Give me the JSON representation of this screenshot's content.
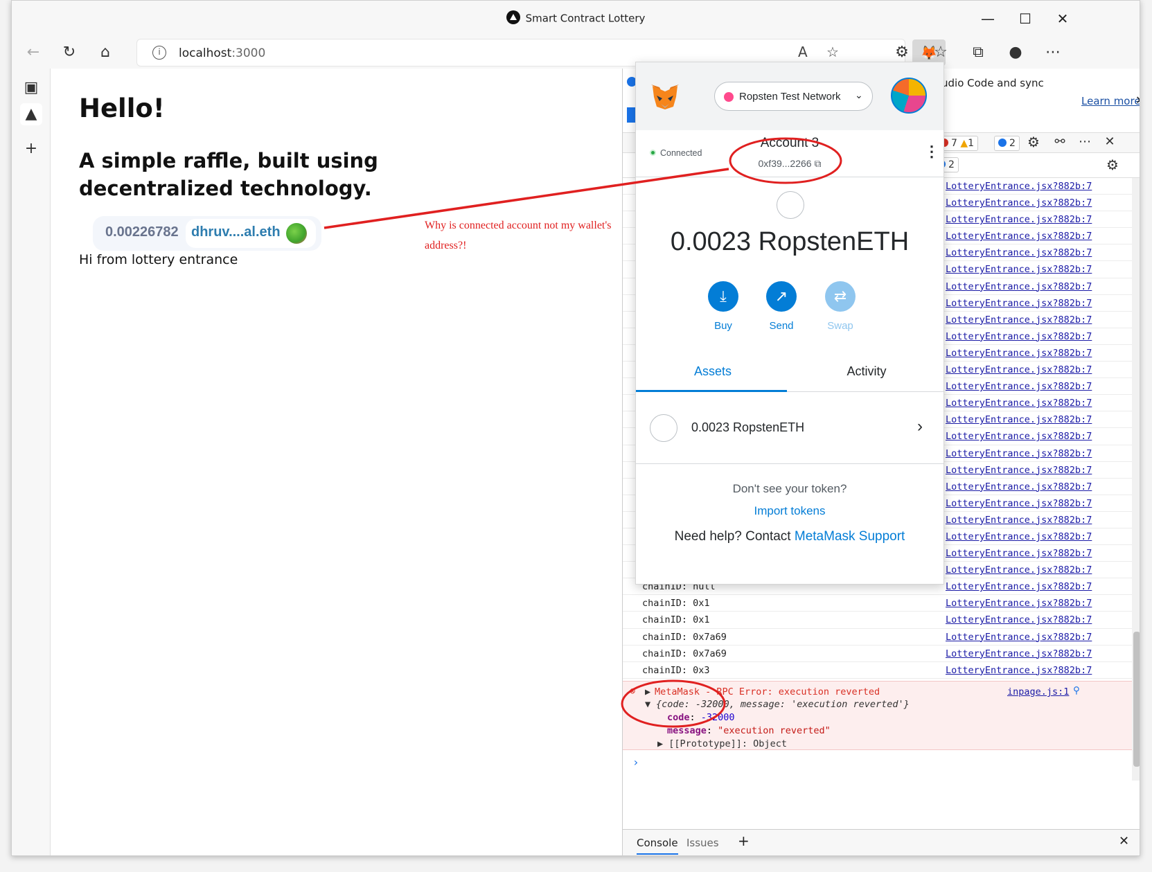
{
  "window": {
    "title": "Smart Contract Lottery"
  },
  "toolbar": {
    "url_host": "localhost",
    "url_port": ":3000"
  },
  "page": {
    "heading": "Hello!",
    "subtitle": "A simple raffle, built using decentralized technology.",
    "balance": "0.00226782",
    "ens": "dhruv....al.eth",
    "entrance_text": "Hi from lottery entrance",
    "annotation": "Why is connected account not my wallet's address?!"
  },
  "devtools": {
    "banner_text": "udio Code and sync",
    "learn_more": "Learn more",
    "errors": "7",
    "warnings": "1",
    "info": "2",
    "info2": "2",
    "log_source": "LotteryEntrance.jsx?882b:7",
    "log_rows": [
      "",
      "",
      "",
      "",
      "",
      "",
      "",
      "",
      "",
      "",
      "",
      "",
      "",
      "",
      "",
      "",
      "",
      "",
      "",
      "",
      "",
      "",
      "",
      "chainID: null",
      "chainID: null",
      "chainID: 0x1",
      "chainID: 0x1",
      "chainID: 0x7a69",
      "chainID: 0x7a69",
      "chainID: 0x3",
      "chainID: 0x3"
    ],
    "error": {
      "title": "MetaMask - RPC Error: execution reverted",
      "source": "inpage.js:1",
      "object": "{code: -32000, message: 'execution reverted'}",
      "code_key": "code",
      "code_val": "-32000",
      "message_key": "message",
      "message_val": "\"execution reverted\"",
      "proto": "[[Prototype]]: Object"
    },
    "drawer": {
      "console": "Console",
      "issues": "Issues"
    }
  },
  "metamask": {
    "network": "Ropsten Test Network",
    "connected": "Connected",
    "account_name": "Account 3",
    "address": "0xf39...2266",
    "balance": "0.0023 RopstenETH",
    "buy": "Buy",
    "send": "Send",
    "swap": "Swap",
    "tab_assets": "Assets",
    "tab_activity": "Activity",
    "asset_name": "0.0023 RopstenETH",
    "dont_see": "Don't see your token?",
    "import": "Import tokens",
    "help_prefix": "Need help? Contact ",
    "help_link": "MetaMask Support"
  },
  "colors": {
    "metamask_blue": "#037dd6",
    "annotation_red": "#e02020",
    "error_red": "#d93025"
  }
}
